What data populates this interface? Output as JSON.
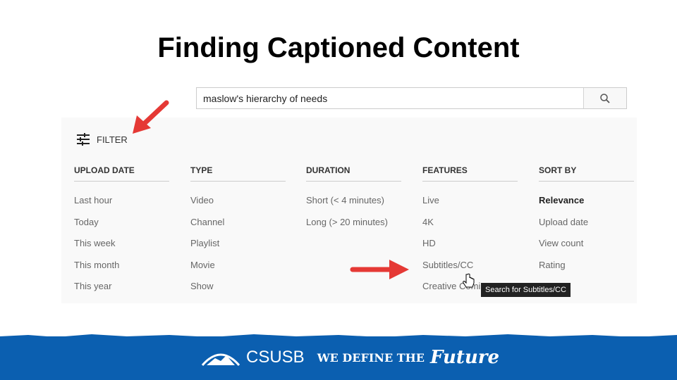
{
  "slide": {
    "title": "Finding Captioned Content"
  },
  "search": {
    "query": "maslow's hierarchy of needs",
    "icon": "search-icon"
  },
  "filter": {
    "label": "FILTER",
    "icon": "sliders-icon",
    "columns": [
      {
        "header": "UPLOAD DATE",
        "items": [
          "Last hour",
          "Today",
          "This week",
          "This month",
          "This year"
        ]
      },
      {
        "header": "TYPE",
        "items": [
          "Video",
          "Channel",
          "Playlist",
          "Movie",
          "Show"
        ]
      },
      {
        "header": "DURATION",
        "items": [
          "Short (< 4 minutes)",
          "Long (> 20 minutes)"
        ]
      },
      {
        "header": "FEATURES",
        "items": [
          "Live",
          "4K",
          "HD",
          "Subtitles/CC",
          "Creative Comi"
        ]
      },
      {
        "header": "SORT BY",
        "items": [
          "Relevance",
          "Upload date",
          "View count",
          "Rating"
        ]
      }
    ],
    "selected_sort": "Relevance"
  },
  "tooltip": "Search for Subtitles/CC",
  "footer": {
    "logo": "CSUSB",
    "tagline": "WE DEFINE THE",
    "tagline_script": "Future",
    "color": "#0b5fb0"
  },
  "arrow_color": "#e53935"
}
